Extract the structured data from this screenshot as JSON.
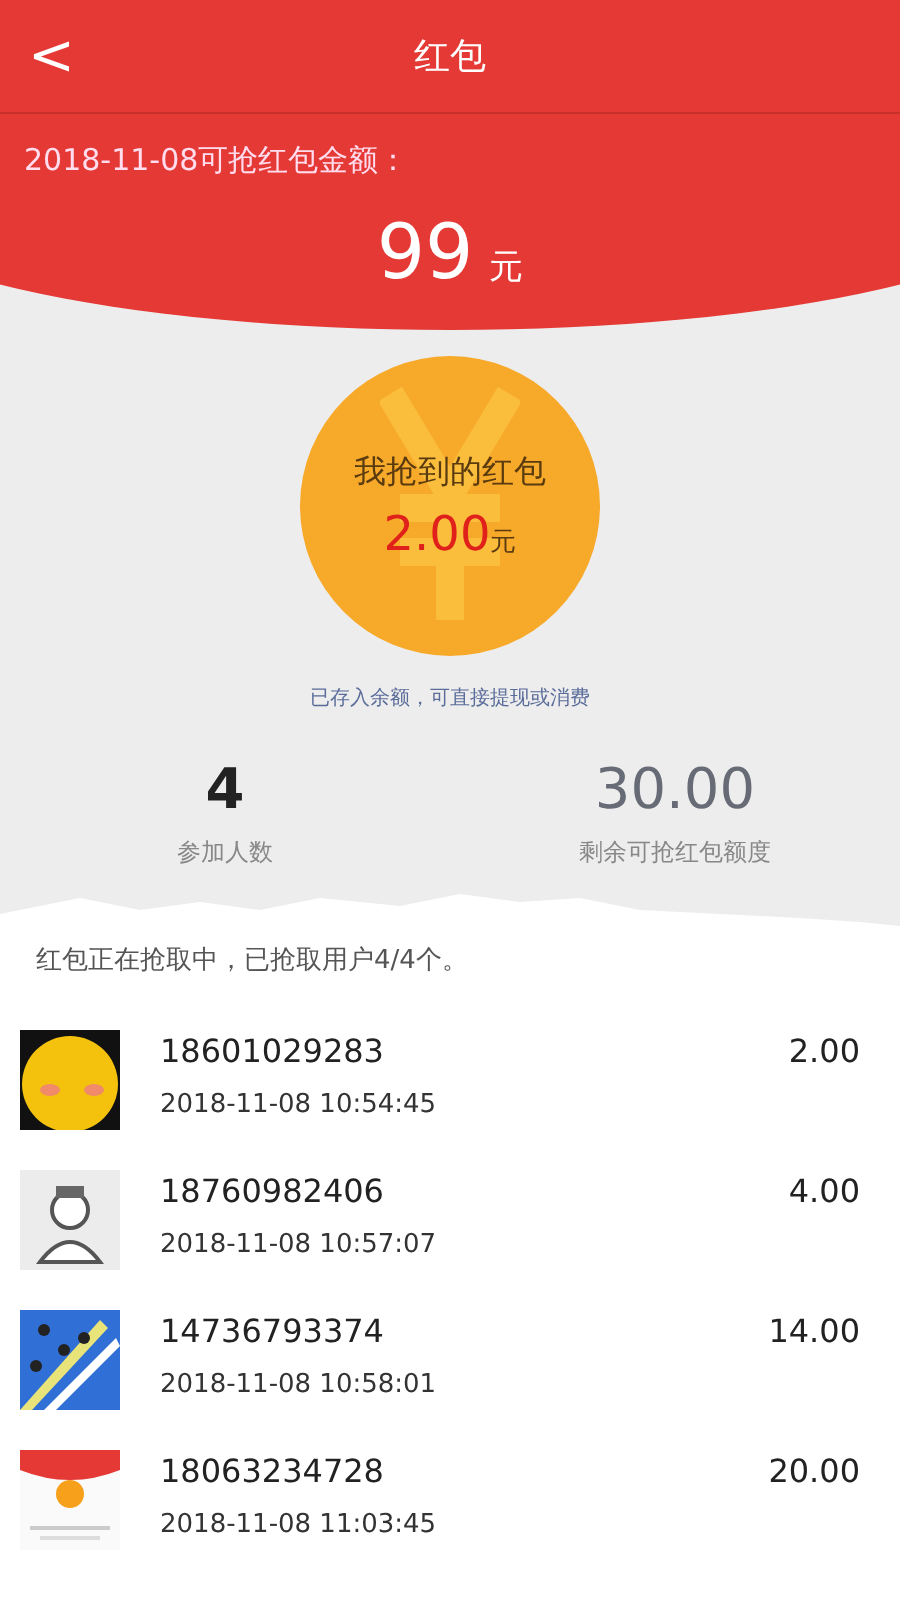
{
  "header": {
    "back_icon": "<",
    "title": "红包"
  },
  "banner": {
    "caption": "2018-11-08可抢红包金额：",
    "amount": "99",
    "unit": "元"
  },
  "coin": {
    "label": "我抢到的红包",
    "amount": "2.00",
    "unit": "元"
  },
  "note": "已存入余额，可直接提现或消费",
  "stats": [
    {
      "value": "4",
      "label": "参加人数",
      "kind": "dark"
    },
    {
      "value": "30.00",
      "label": "剩余可抢红包额度",
      "kind": "muted"
    }
  ],
  "status": "红包正在抢取中，已抢取用户4/4个。",
  "records": [
    {
      "phone": "18601029283",
      "time": "2018-11-08 10:54:45",
      "amount": "2.00"
    },
    {
      "phone": "18760982406",
      "time": "2018-11-08 10:57:07",
      "amount": "4.00"
    },
    {
      "phone": "14736793374",
      "time": "2018-11-08 10:58:01",
      "amount": "14.00"
    },
    {
      "phone": "18063234728",
      "time": "2018-11-08 11:03:45",
      "amount": "20.00"
    }
  ]
}
